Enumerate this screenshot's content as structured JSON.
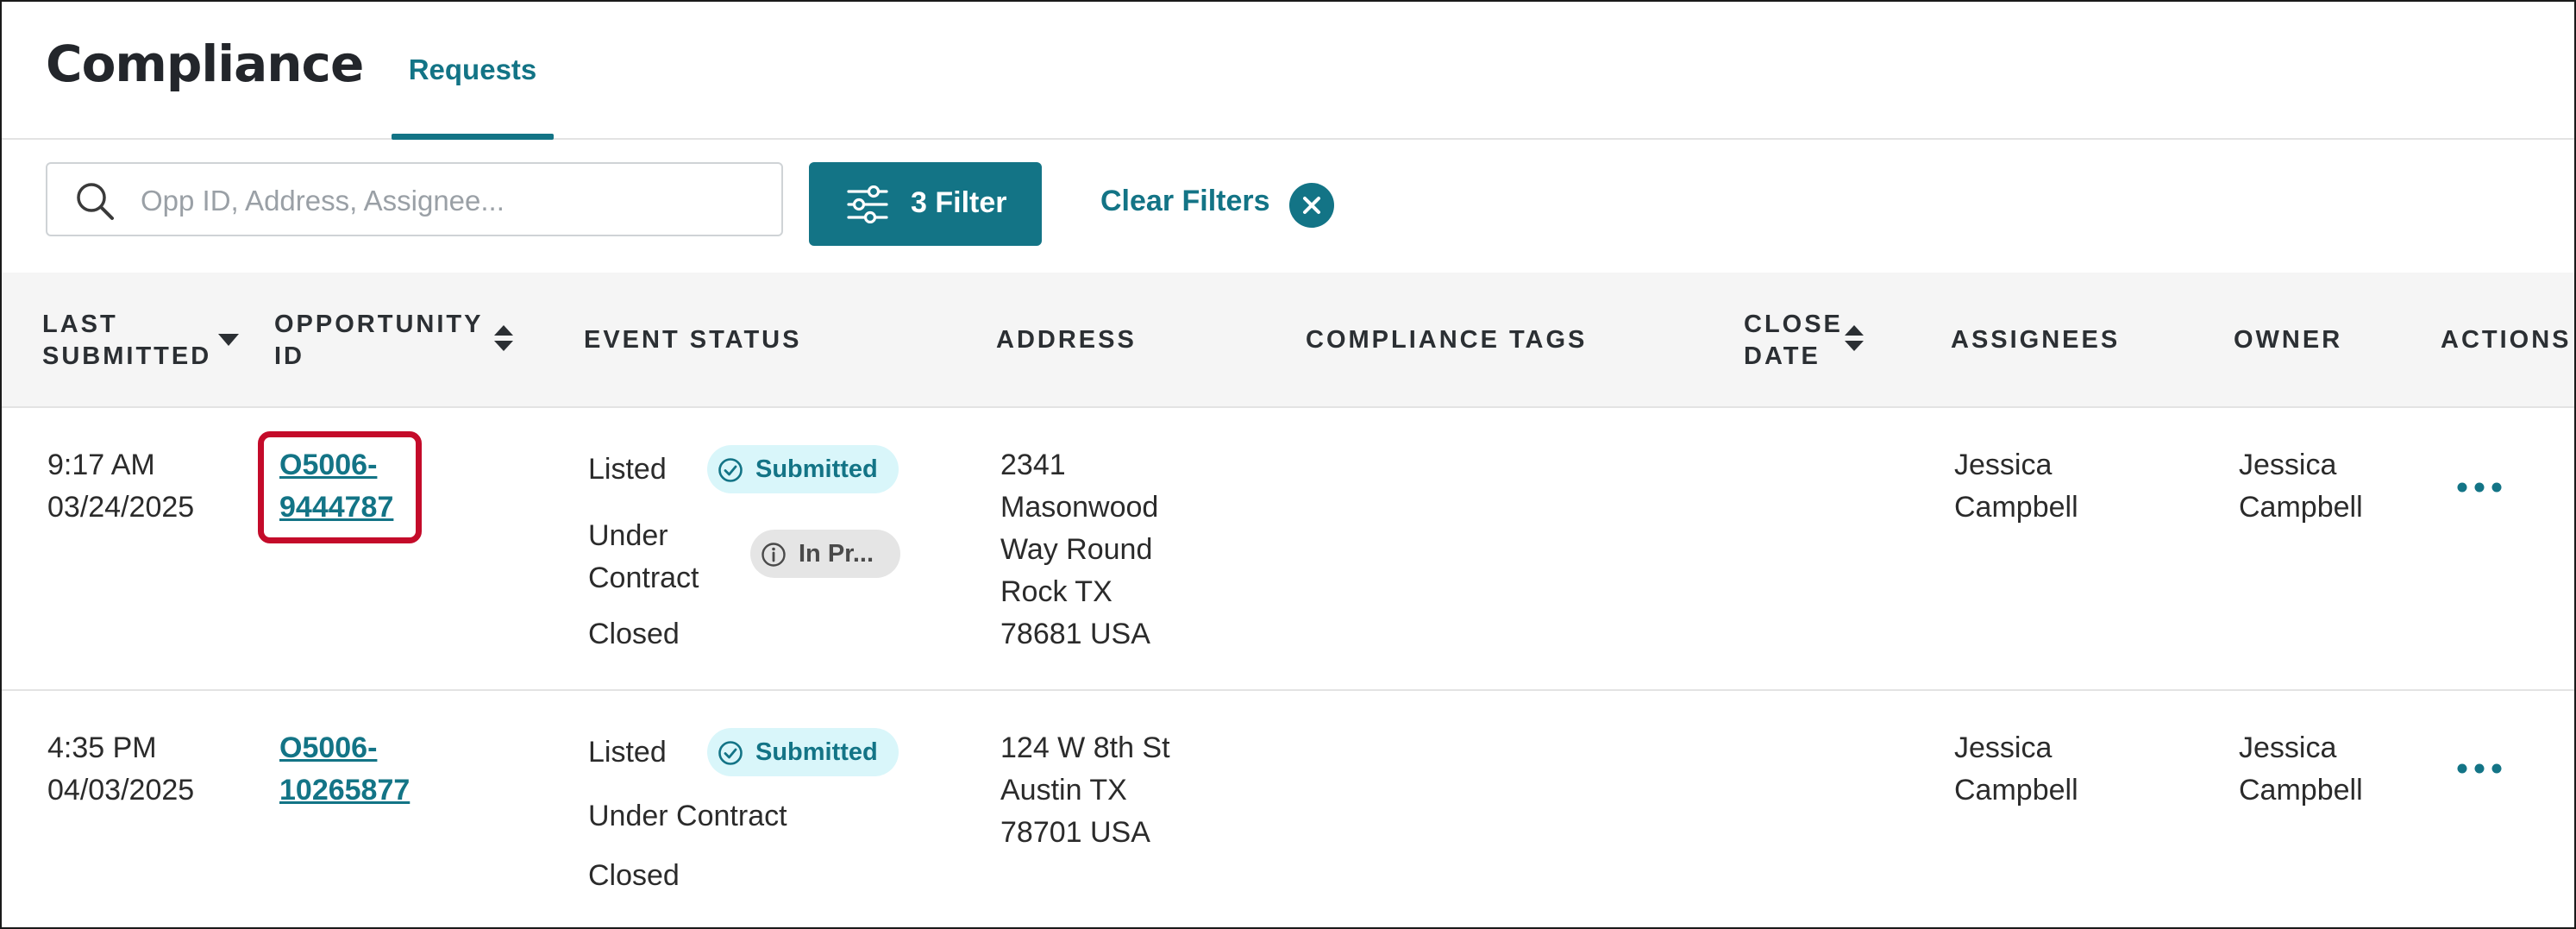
{
  "app": {
    "title": "Compliance"
  },
  "tabs": [
    {
      "label": "Requests",
      "active": true
    }
  ],
  "toolbar": {
    "search_placeholder": "Opp ID, Address, Assignee...",
    "filter_label": "3 Filter",
    "clear_filters_label": "Clear Filters"
  },
  "table": {
    "headers": {
      "last_submitted": [
        "LAST",
        "SUBMITTED"
      ],
      "opportunity_id": [
        "OPPORTUNITY",
        "ID"
      ],
      "event_status": "EVENT STATUS",
      "address": "ADDRESS",
      "compliance_tags": "COMPLIANCE TAGS",
      "close_date": [
        "CLOSE",
        "DATE"
      ],
      "assignees": "ASSIGNEES",
      "owner": "OWNER",
      "actions": "ACTIONS"
    },
    "rows": [
      {
        "time": "9:17 AM",
        "date": "03/24/2025",
        "opp_id": [
          "O5006-",
          "9444787"
        ],
        "statuses": [
          {
            "label": "Listed",
            "badge": "Submitted"
          },
          {
            "label": [
              "Under",
              "Contract"
            ],
            "badge": "In Pr..."
          },
          {
            "label": "Closed"
          }
        ],
        "address": [
          "2341",
          "Masonwood",
          "Way Round",
          "Rock TX",
          "78681 USA"
        ],
        "compliance_tags": "",
        "close_date": "",
        "assignee": [
          "Jessica",
          "Campbell"
        ],
        "owner": [
          "Jessica",
          "Campbell"
        ]
      },
      {
        "time": "4:35 PM",
        "date": "04/03/2025",
        "opp_id": [
          "O5006-",
          "10265877"
        ],
        "statuses": [
          {
            "label": "Listed",
            "badge": "Submitted"
          },
          {
            "label": "Under Contract"
          },
          {
            "label": "Closed"
          }
        ],
        "address": [
          "124 W 8th St",
          "Austin TX",
          "78701 USA"
        ],
        "compliance_tags": "",
        "close_date": "",
        "assignee": [
          "Jessica",
          "Campbell"
        ],
        "owner": [
          "Jessica",
          "Campbell"
        ]
      }
    ]
  },
  "colors": {
    "accent": "#137486",
    "highlight": "#c40b2a",
    "submitted_badge_bg": "#d9f6fa",
    "progress_badge_bg": "#e5e5e5"
  },
  "icons": [
    "search-icon",
    "filter-sliders-icon",
    "close-circle-icon",
    "sort-icon",
    "sort-desc-icon",
    "check-circle-icon",
    "info-circle-icon",
    "more-horizontal-icon"
  ]
}
